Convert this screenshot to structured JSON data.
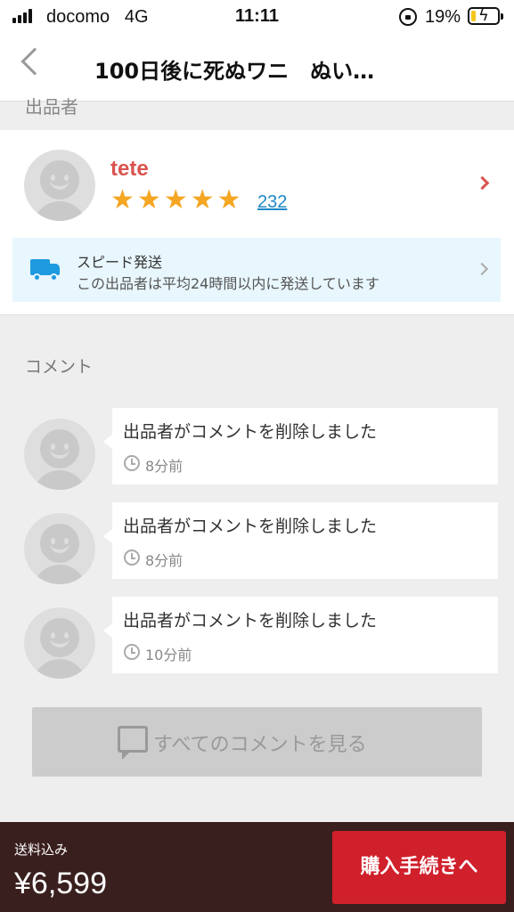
{
  "status_bar": {
    "carrier": "docomo",
    "network": "4G",
    "time": "11:11",
    "battery_percent": "19%",
    "battery_level": 0.19,
    "icons": [
      "signal-icon",
      "rotation-lock-icon",
      "battery-icon"
    ]
  },
  "nav": {
    "title": "100日後に死ぬワニ　ぬい…",
    "back_icon": "chevron-left-icon"
  },
  "seller": {
    "section_label": "出品者",
    "name": "tete",
    "rating_stars": 5,
    "review_count": "232",
    "colors": {
      "name": "#d9534f",
      "stars": "#f5a623",
      "link": "#1e88c7"
    },
    "speed": {
      "title": "スピード発送",
      "description": "この出品者は平均24時間以内に発送しています",
      "icon": "truck-icon"
    }
  },
  "comments": {
    "section_label": "コメント",
    "items": [
      {
        "text": "出品者がコメントを削除しました",
        "time": "8分前"
      },
      {
        "text": "出品者がコメントを削除しました",
        "time": "8分前"
      },
      {
        "text": "出品者がコメントを削除しました",
        "time": "10分前"
      }
    ],
    "see_all_label": "すべてのコメントを見る"
  },
  "purchase": {
    "shipping_label": "送料込み",
    "price": "¥6,599",
    "buy_label": "購入手続きへ",
    "button_color": "#d0202b"
  }
}
